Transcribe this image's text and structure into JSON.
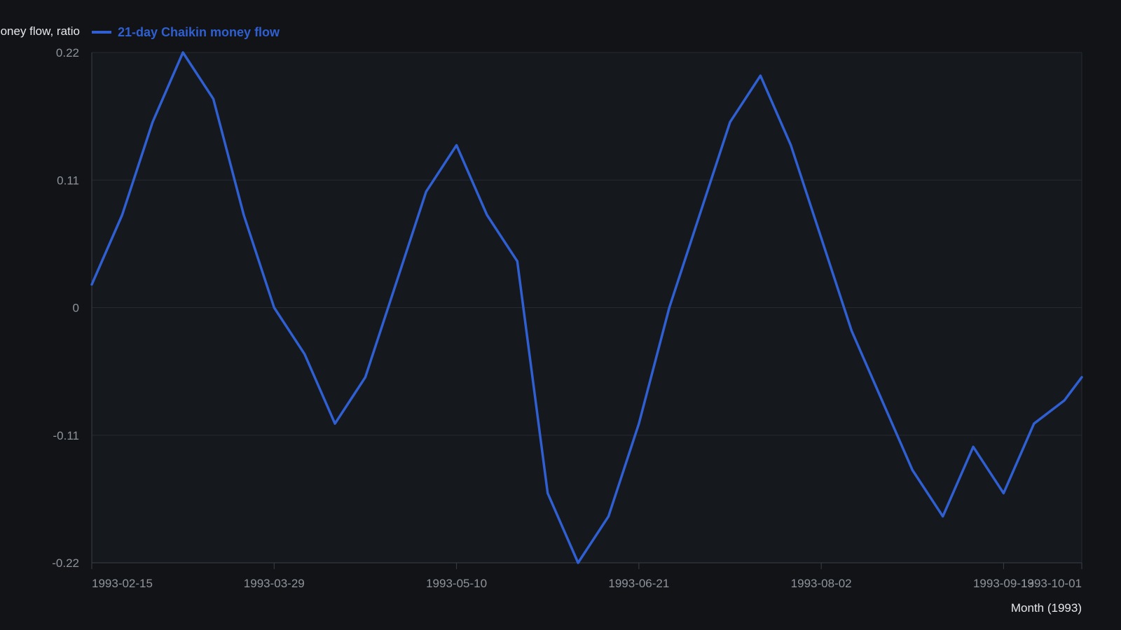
{
  "chart_data": {
    "type": "line",
    "xlabel": "Month (1993)",
    "ylabel": "Chaikin money flow, ratio",
    "ylim": [
      -0.22,
      0.22
    ],
    "yticks": [
      -0.22,
      -0.11,
      0,
      0.11,
      0.22
    ],
    "ytick_labels": [
      "-0.22",
      "-0.11",
      "0",
      "0.11",
      "0.22"
    ],
    "xlim": [
      "1993-02-15",
      "1993-10-01"
    ],
    "xticks": [
      "1993-02-15",
      "1993-03-29",
      "1993-05-10",
      "1993-06-21",
      "1993-08-02",
      "1993-09-13",
      "1993-10-01"
    ],
    "grid": true,
    "legend_position": "top-left",
    "colors": {
      "background": "#111317",
      "plot_background": "#15181d",
      "series": "#2f5fd0",
      "grid": "#262a31",
      "axis": "#3a3f47"
    },
    "series": [
      {
        "name": "21-day Chaikin money flow",
        "x": [
          "1993-02-15",
          "1993-02-22",
          "1993-03-01",
          "1993-03-08",
          "1993-03-15",
          "1993-03-22",
          "1993-03-29",
          "1993-04-05",
          "1993-04-12",
          "1993-04-19",
          "1993-04-26",
          "1993-05-03",
          "1993-05-10",
          "1993-05-17",
          "1993-05-24",
          "1993-05-31",
          "1993-06-07",
          "1993-06-14",
          "1993-06-21",
          "1993-06-28",
          "1993-07-05",
          "1993-07-12",
          "1993-07-19",
          "1993-07-26",
          "1993-08-02",
          "1993-08-09",
          "1993-08-16",
          "1993-08-23",
          "1993-08-30",
          "1993-09-06",
          "1993-09-13",
          "1993-09-20",
          "1993-09-27",
          "1993-10-01"
        ],
        "values": [
          0.02,
          0.08,
          0.16,
          0.22,
          0.18,
          0.08,
          0.0,
          -0.04,
          -0.1,
          -0.06,
          0.02,
          0.1,
          0.14,
          0.08,
          0.04,
          -0.16,
          -0.22,
          -0.18,
          -0.1,
          0.0,
          0.08,
          0.16,
          0.2,
          0.14,
          0.06,
          -0.02,
          -0.08,
          -0.14,
          -0.18,
          -0.12,
          -0.16,
          -0.1,
          -0.08,
          -0.06
        ]
      }
    ]
  }
}
